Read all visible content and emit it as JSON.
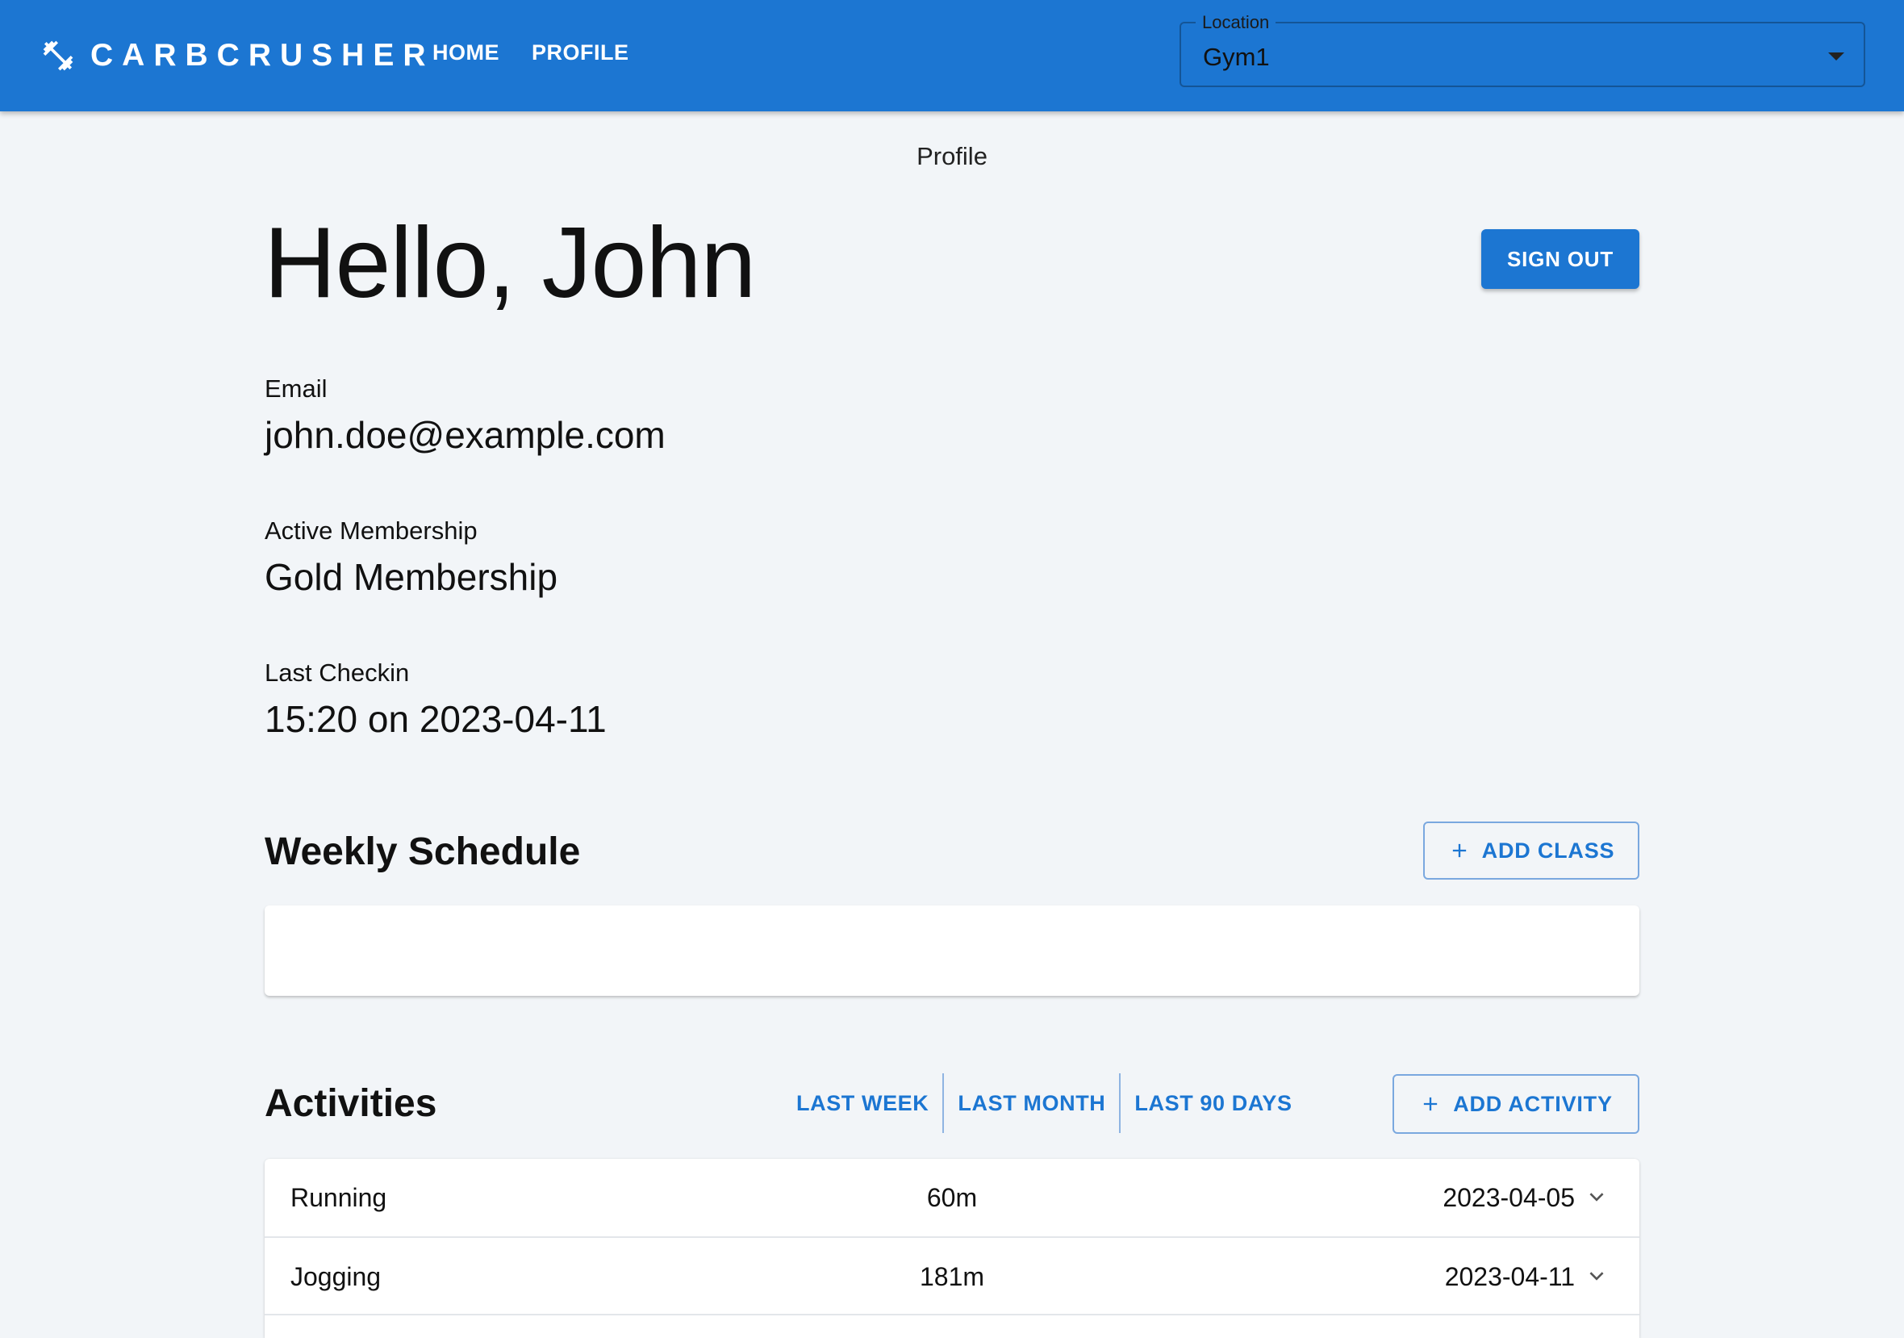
{
  "app": {
    "brand": "CARBCRUSHER",
    "nav": [
      {
        "label": "HOME"
      },
      {
        "label": "PROFILE"
      }
    ],
    "location": {
      "label": "Location",
      "value": "Gym1"
    }
  },
  "page": {
    "label": "Profile",
    "greeting": "Hello, John",
    "sign_out": "SIGN OUT",
    "fields": {
      "email": {
        "label": "Email",
        "value": "john.doe@example.com"
      },
      "membership": {
        "label": "Active Membership",
        "value": "Gold Membership"
      },
      "checkin": {
        "label": "Last Checkin",
        "value": "15:20 on 2023-04-11"
      }
    }
  },
  "schedule": {
    "title": "Weekly Schedule",
    "add_label": "ADD CLASS"
  },
  "activities": {
    "title": "Activities",
    "ranges": [
      "LAST WEEK",
      "LAST MONTH",
      "LAST 90 DAYS"
    ],
    "add_label": "ADD ACTIVITY",
    "rows": [
      {
        "name": "Running",
        "duration": "60m",
        "date": "2023-04-05"
      },
      {
        "name": "Jogging",
        "duration": "181m",
        "date": "2023-04-11"
      }
    ]
  },
  "colors": {
    "primary": "#1c76d2",
    "background": "#f2f5f8"
  },
  "icons": {
    "brand": "dumbbell-icon",
    "add": "plus-icon",
    "expand": "chevron-down-icon",
    "dropdown": "caret-down-icon"
  }
}
